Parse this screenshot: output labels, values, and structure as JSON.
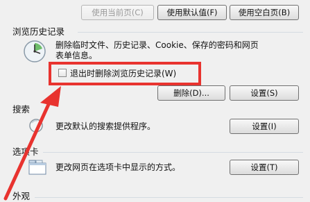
{
  "homepage": {
    "use_current_label": "使用当前页(C)",
    "use_default_label": "使用默认值(F)",
    "use_blank_label": "使用空白页(B)"
  },
  "history": {
    "title": "浏览历史记录",
    "description_line1": "删除临时文件、历史记录、Cookie、保存的密码和网页",
    "description_line2": "表单信息。",
    "checkbox_label": "退出时删除浏览历史记录(W)",
    "checkbox_checked": false,
    "delete_label": "删除(D)...",
    "settings_label": "设置(S)"
  },
  "search": {
    "title": "搜索",
    "description": "更改默认的搜索提供程序。",
    "settings_label": "设置(I)"
  },
  "tabs": {
    "title": "选项卡",
    "description": "更改网页在选项卡中显示的方式。",
    "settings_label": "设置(T)"
  },
  "appearance": {
    "title": "外观"
  },
  "colors": {
    "annotation_red": "#e8332f",
    "background": "#f0f0f0"
  },
  "icons": {
    "history": "clock-icon",
    "search": "magnifier-icon",
    "tabs": "tabs-window-icon"
  }
}
